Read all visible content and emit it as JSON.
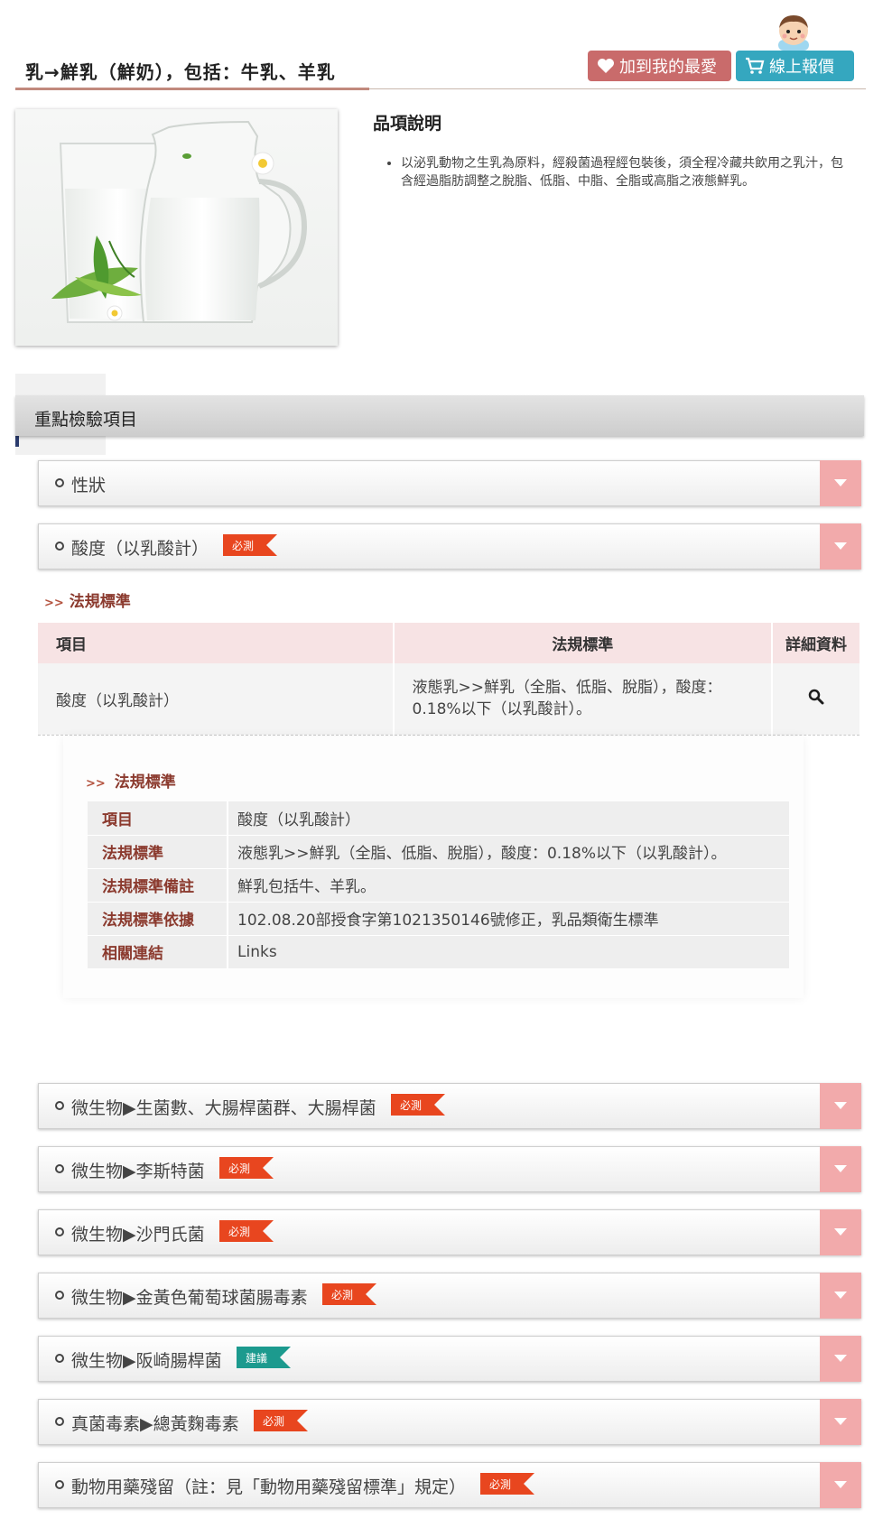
{
  "header": {
    "title": "乳→鮮乳（鮮奶），包括：牛乳、羊乳",
    "favorite_button": "加到我的最愛",
    "quote_button": "線上報價"
  },
  "product": {
    "image_icon": "milk-jug-photo",
    "description_heading": "品項說明",
    "description_items": [
      "以泌乳動物之生乳為原料，經殺菌過程經包裝後，須全程冷藏共飲用之乳汁，包含經過脂肪調整之脫脂、低脂、中脂、全脂或高脂之液態鮮乳。"
    ]
  },
  "section": {
    "title": "重點檢驗項目"
  },
  "tags": {
    "required": "必測",
    "suggested": "建議"
  },
  "colors": {
    "required_tag": "#e8461f",
    "suggested_tag": "#1c9a8e",
    "toggle": "#f2aaab",
    "regulation_heading": "#8b3a2e"
  },
  "accordion": [
    {
      "label": "性狀",
      "tag": null
    },
    {
      "label": "酸度（以乳酸計）",
      "tag": "必測"
    },
    {
      "label": "微生物▶生菌數、大腸桿菌群、大腸桿菌",
      "tag": "必測"
    },
    {
      "label": "微生物▶李斯特菌",
      "tag": "必測"
    },
    {
      "label": "微生物▶沙門氏菌",
      "tag": "必測"
    },
    {
      "label": "微生物▶金黃色葡萄球菌腸毒素",
      "tag": "必測"
    },
    {
      "label": "微生物▶阪崎腸桿菌",
      "tag": "建議"
    },
    {
      "label": "真菌毒素▶總黃麴毒素",
      "tag": "必測"
    },
    {
      "label": "動物用藥殘留（註：見「動物用藥殘留標準」規定）",
      "tag": "必測"
    }
  ],
  "regulation": {
    "heading_arrow": ">>",
    "heading": "法規標準",
    "columns": [
      "項目",
      "法規標準",
      "詳細資料"
    ],
    "row": {
      "item": "酸度（以乳酸計）",
      "standard": "液態乳>>鮮乳（全脂、低脂、脫脂），酸度：0.18%以下（以乳酸計）。",
      "detail_icon": "magnifier-icon"
    }
  },
  "detail": {
    "heading": "法規標準",
    "rows": [
      {
        "key": "項目",
        "value": "酸度（以乳酸計）"
      },
      {
        "key": "法規標準",
        "value": "液態乳>>鮮乳（全脂、低脂、脫脂），酸度：0.18%以下（以乳酸計）。"
      },
      {
        "key": "法規標準備註",
        "value": "鮮乳包括牛、羊乳。"
      },
      {
        "key": "法規標準依據",
        "value": "102.08.20部授食字第1021350146號修正，乳品類衛生標準"
      },
      {
        "key": "相關連結",
        "value": "Links"
      }
    ]
  }
}
